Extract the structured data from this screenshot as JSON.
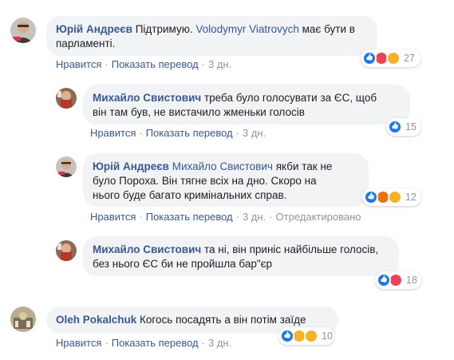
{
  "comments": [
    {
      "author": "Юрій Андреєв",
      "mention": "",
      "text_before": " Підтримую. ",
      "link": "Volodymyr Viatrovych",
      "text_after": " має бути в",
      "text_line2": "парламенті.",
      "like": "Нравится",
      "translate": "Показать перевод",
      "time": "3 дн.",
      "reactions": [
        "like",
        "love",
        "haha"
      ],
      "reaction_count": "27"
    },
    {
      "author": "Михайло Свистович",
      "text_line1": " треба було голосувати за ЄС, щоб",
      "text_line2": "він там був, не вистачило жменьки голосів",
      "like": "Нравится",
      "translate": "Показать перевод",
      "time": "3 дн.",
      "reactions": [
        "like"
      ],
      "reaction_count": "15"
    },
    {
      "author": "Юрій Андреєв",
      "mention": "Михайло Свистович",
      "text_line1": " якби так не",
      "text_line2": "було Пороха. Він тягне всіх на дно. Скоро на",
      "text_line3": "нього буде багато кримінальних справ.",
      "like": "Нравится",
      "translate": "Показать перевод",
      "time": "3 дн.",
      "edited": "Отредактировано",
      "reactions": [
        "like",
        "angry",
        "haha"
      ],
      "reaction_count": "12"
    },
    {
      "author": "Михайло Свистович",
      "text_line1": " та ні, він приніс найбільше голосів,",
      "text_line2": "без нього ЄС би не пройшла бар\"єр",
      "like": "Нравится",
      "translate": "Показать перевод",
      "time": "3 дн.",
      "reactions": [
        "like",
        "love"
      ],
      "reaction_count": "18"
    },
    {
      "author": "Oleh Pokalchuk",
      "text_line1": " Когось посадять а він потім заїде",
      "like": "Нравится",
      "translate": "Показать перевод",
      "time": "3 дн.",
      "reactions": [
        "like",
        "haha",
        "haha"
      ],
      "reaction_count": "10"
    }
  ],
  "sep": "·",
  "colors": {
    "link": "#385898",
    "bubble": "#f2f3f5",
    "meta": "#90949c"
  }
}
